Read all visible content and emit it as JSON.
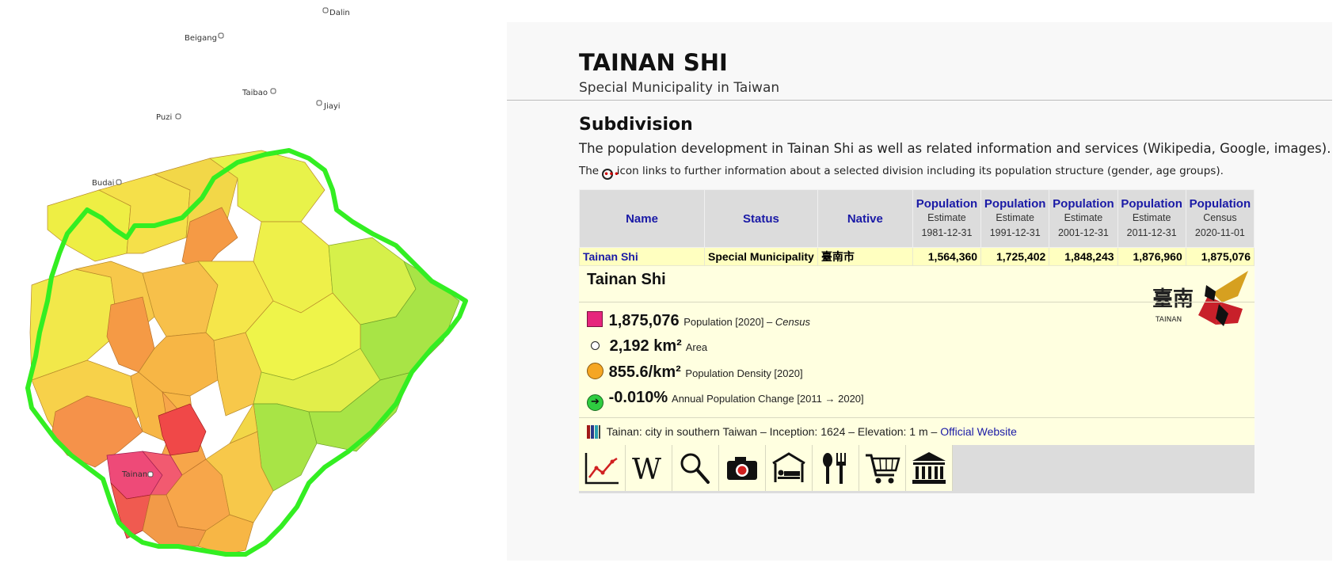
{
  "map": {
    "towns": [
      "Dalin",
      "Beigang",
      "Taibao",
      "Jiayi",
      "Puzi",
      "Budai",
      "Tainan"
    ]
  },
  "header": {
    "title": "TAINAN SHI",
    "subtitle": "Special Municipality in Taiwan"
  },
  "section": {
    "title": "Subdivision",
    "intro": "The population development in Tainan Shi as well as related information and services (Wikipedia, Google, images).",
    "note_before": "The",
    "note_after": "icon links to further information about a selected division including its population structure (gender, age groups)."
  },
  "table": {
    "columns": {
      "name": "Name",
      "status": "Status",
      "native": "Native",
      "pop": [
        {
          "label": "Population",
          "kind": "Estimate",
          "date": "1981-12-31"
        },
        {
          "label": "Population",
          "kind": "Estimate",
          "date": "1991-12-31"
        },
        {
          "label": "Population",
          "kind": "Estimate",
          "date": "2001-12-31"
        },
        {
          "label": "Population",
          "kind": "Estimate",
          "date": "2011-12-31"
        },
        {
          "label": "Population",
          "kind": "Census",
          "date": "2020-11-01"
        }
      ]
    },
    "row": {
      "name": "Tainan Shi",
      "status": "Special Municipality",
      "native": "臺南市",
      "values": [
        "1,564,360",
        "1,725,402",
        "1,848,243",
        "1,876,960",
        "1,875,076"
      ]
    }
  },
  "detail": {
    "title": "Tainan Shi",
    "logo_text": "TAINAN",
    "logo_chars": "臺南",
    "population": {
      "value": "1,875,076",
      "label": "Population [2020] –",
      "source": "Census",
      "color": "#e6257c"
    },
    "area": {
      "value": "2,192 km²",
      "label": "Area"
    },
    "density": {
      "value": "855.6/km²",
      "label": "Population Density [2020]",
      "color": "#f5a623"
    },
    "change": {
      "value": "-0.010%",
      "label": "Annual Population Change [2011 → 2020]",
      "color": "#2ecc40"
    },
    "description": "Tainan: city in southern Taiwan – Inception: 1624 – Elevation: 1 m –",
    "website_label": "Official Website"
  },
  "icons": [
    "chart-icon",
    "wikipedia-icon",
    "search-icon",
    "camera-icon",
    "hotel-icon",
    "restaurant-icon",
    "shopping-cart-icon",
    "museum-icon"
  ],
  "colors": {
    "link": "#1a1aa6",
    "row_bg": "#ffffc0",
    "detail_bg": "#ffffe0",
    "border_green": "#33ee22"
  }
}
